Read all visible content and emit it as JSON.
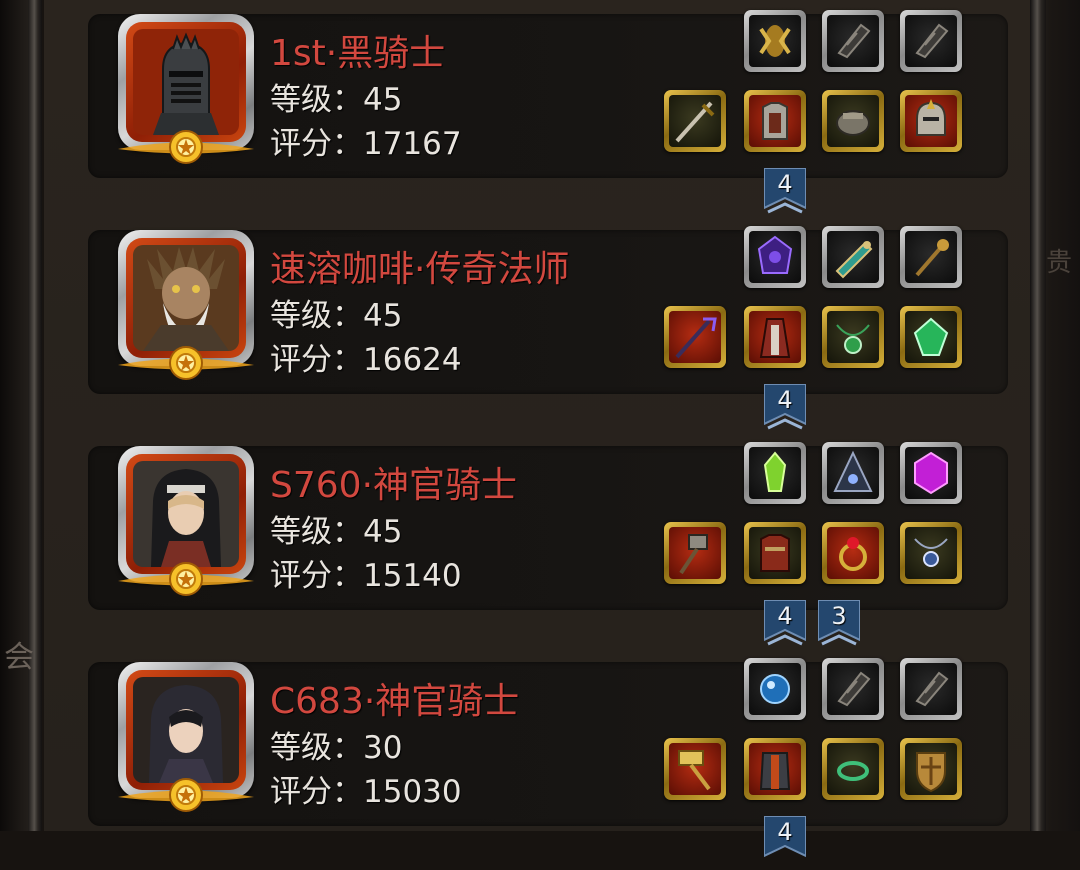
{
  "side_labels": {
    "left": "会",
    "right": "贵"
  },
  "players": [
    {
      "name": "1st·黑骑士",
      "level": "等级：45",
      "score": "评分：17167",
      "portrait": "dark-knight-helmet"
    },
    {
      "name": "速溶咖啡·传奇法师",
      "level": "等级：45",
      "score": "评分：16624",
      "portrait": "bearded-mage"
    },
    {
      "name": "S760·神官骑士",
      "level": "等级：45",
      "score": "评分：15140",
      "portrait": "hooded-priestess"
    },
    {
      "name": "C683·神官骑士",
      "level": "等级：30",
      "score": "评分：15030",
      "portrait": "veiled-priestess"
    }
  ],
  "set_tabs": [
    {
      "value": "4"
    },
    {
      "value": "4"
    },
    {
      "value": "4"
    },
    {
      "value": "3"
    },
    {
      "value": "4"
    }
  ],
  "colors": {
    "name_red": "#d2483f",
    "stat_text": "#e8e4de",
    "tab_blue": "#24476e",
    "gold_quality": "#d6b03a",
    "gray_quality": "#b5b5b5",
    "red_quality": "#b52c12"
  }
}
